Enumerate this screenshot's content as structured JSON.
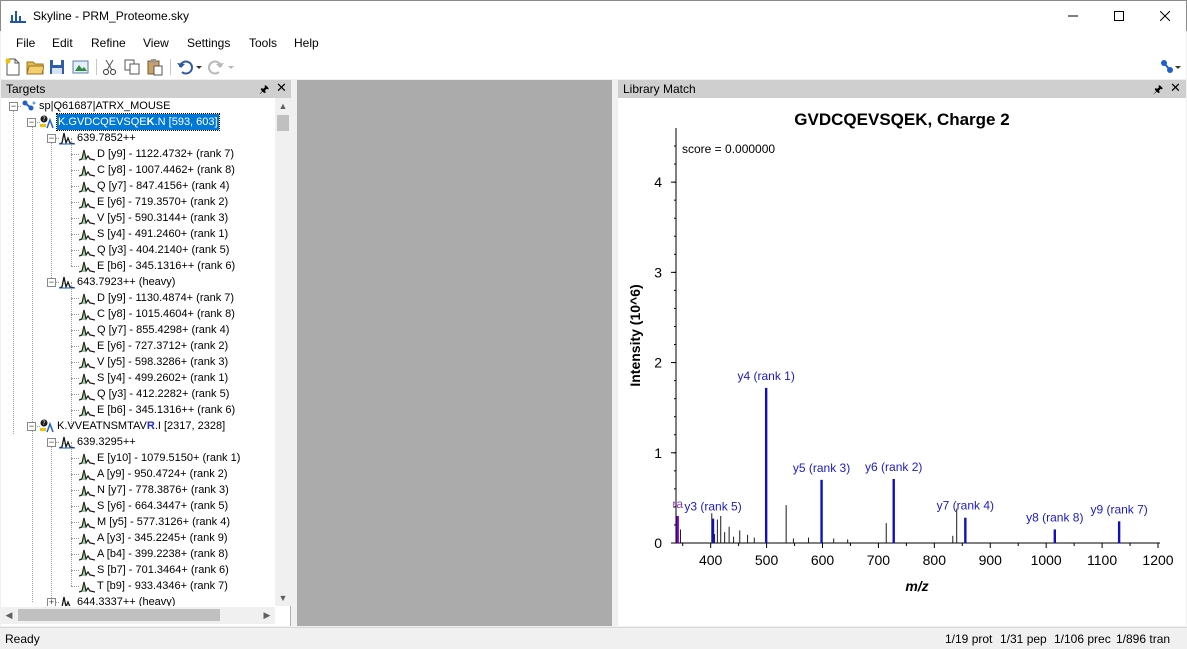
{
  "window": {
    "title": "Skyline - PRM_Proteome.sky"
  },
  "menu": [
    "File",
    "Edit",
    "Refine",
    "View",
    "Settings",
    "Tools",
    "Help"
  ],
  "targets_pane": {
    "title": "Targets"
  },
  "tree": [
    {
      "label": "sp|Q61687|ATRX_MOUSE"
    },
    {
      "label_pre": "K.GVDCQEVSQE",
      "label_bold": "K",
      "label_post": ".N [593, 603]"
    },
    {
      "label": "639.7852++"
    },
    {
      "label": "D [y9] - 1122.4732+ (rank 7)"
    },
    {
      "label": "C [y8] - 1007.4462+ (rank 8)"
    },
    {
      "label": "Q [y7] - 847.4156+ (rank 4)"
    },
    {
      "label": "E [y6] - 719.3570+ (rank 2)"
    },
    {
      "label": "V [y5] - 590.3144+ (rank 3)"
    },
    {
      "label": "S [y4] - 491.2460+ (rank 1)"
    },
    {
      "label": "Q [y3] - 404.2140+ (rank 5)"
    },
    {
      "label": "E [b6] - 345.1316++ (rank 6)"
    },
    {
      "label": "643.7923++ (heavy)"
    },
    {
      "label": "D [y9] - 1130.4874+ (rank 7)"
    },
    {
      "label": "C [y8] - 1015.4604+ (rank 8)"
    },
    {
      "label": "Q [y7] - 855.4298+ (rank 4)"
    },
    {
      "label": "E [y6] - 727.3712+ (rank 2)"
    },
    {
      "label": "V [y5] - 598.3286+ (rank 3)"
    },
    {
      "label": "S [y4] - 499.2602+ (rank 1)"
    },
    {
      "label": "Q [y3] - 412.2282+ (rank 5)"
    },
    {
      "label": "E [b6] - 345.1316++ (rank 6)"
    },
    {
      "label_pre": "K.VVEATNSMTAV",
      "label_bold": "R",
      "label_post": ".I [2317, 2328]"
    },
    {
      "label": "639.3295++"
    },
    {
      "label": "E [y10] - 1079.5150+ (rank 1)"
    },
    {
      "label": "A [y9] - 950.4724+ (rank 2)"
    },
    {
      "label": "N [y7] - 778.3876+ (rank 3)"
    },
    {
      "label": "S [y6] - 664.3447+ (rank 5)"
    },
    {
      "label": "M [y5] - 577.3126+ (rank 4)"
    },
    {
      "label": "A [y3] - 345.2245+ (rank 9)"
    },
    {
      "label": "A [b4] - 399.2238+ (rank 8)"
    },
    {
      "label": "S [b7] - 701.3464+ (rank 6)"
    },
    {
      "label": "T [b9] - 933.4346+ (rank 7)"
    },
    {
      "label": "644.3337++ (heavy)"
    }
  ],
  "library_pane": {
    "title": "Library Match"
  },
  "chart_data": {
    "type": "bar",
    "title": "GVDCQEVSQEK, Charge 2",
    "annotation": "score = 0.000000",
    "xlabel": "m/z",
    "ylabel": "Intensity (10^6)",
    "xlim": [
      338,
      1200
    ],
    "ylim": [
      0,
      4.6
    ],
    "xticks": [
      "400",
      "500",
      "600",
      "700",
      "800",
      "900",
      "1000",
      "1100",
      "1200"
    ],
    "yticks": [
      "0",
      "1",
      "2",
      "3",
      "4"
    ],
    "peaks": [
      {
        "mz": 341,
        "intensity": 0.3,
        "color": "#7a00cc"
      },
      {
        "mz": 346,
        "intensity": 0.15,
        "color": "#1a1a1a"
      },
      {
        "mz": 402,
        "intensity": 0.33,
        "color": "#1a1a1a"
      },
      {
        "mz": 407,
        "intensity": 0.1,
        "color": "#1a1a1a"
      },
      {
        "mz": 412,
        "intensity": 0.26,
        "color": "#1a1a1a"
      },
      {
        "mz": 418,
        "intensity": 0.3,
        "color": "#1a1a1a"
      },
      {
        "mz": 425,
        "intensity": 0.12,
        "color": "#1a1a1a"
      },
      {
        "mz": 433,
        "intensity": 0.18,
        "color": "#1a1a1a"
      },
      {
        "mz": 441,
        "intensity": 0.07,
        "color": "#1a1a1a"
      },
      {
        "mz": 452,
        "intensity": 0.14,
        "color": "#1a1a1a"
      },
      {
        "mz": 466,
        "intensity": 0.09,
        "color": "#1a1a1a"
      },
      {
        "mz": 478,
        "intensity": 0.06,
        "color": "#1a1a1a"
      },
      {
        "mz": 535,
        "intensity": 0.42,
        "color": "#1a1a1a"
      },
      {
        "mz": 548,
        "intensity": 0.05,
        "color": "#1a1a1a"
      },
      {
        "mz": 575,
        "intensity": 0.06,
        "color": "#1a1a1a"
      },
      {
        "mz": 620,
        "intensity": 0.05,
        "color": "#1a1a1a"
      },
      {
        "mz": 645,
        "intensity": 0.04,
        "color": "#1a1a1a"
      },
      {
        "mz": 714,
        "intensity": 0.22,
        "color": "#1a1a1a"
      },
      {
        "mz": 833,
        "intensity": 0.08,
        "color": "#1a1a1a"
      },
      {
        "mz": 840,
        "intensity": 0.38,
        "color": "#1a1a1a"
      },
      {
        "mz": 404.214,
        "intensity": 0.27,
        "color": "#1010c0"
      },
      {
        "mz": 499.26,
        "intensity": 1.72,
        "color": "#1010c0"
      },
      {
        "mz": 598.33,
        "intensity": 0.7,
        "color": "#1010c0"
      },
      {
        "mz": 727.37,
        "intensity": 0.71,
        "color": "#1010c0"
      },
      {
        "mz": 855.43,
        "intensity": 0.28,
        "color": "#1010c0"
      },
      {
        "mz": 1015.46,
        "intensity": 0.15,
        "color": "#1010c0"
      },
      {
        "mz": 1130.49,
        "intensity": 0.24,
        "color": "#1010c0"
      }
    ],
    "peak_labels": [
      {
        "text": "y4 (rank 1)",
        "mz": 499.26,
        "intensity": 1.72
      },
      {
        "text": "y5 (rank 3)",
        "mz": 598.33,
        "intensity": 0.7
      },
      {
        "text": "y6 (rank 2)",
        "mz": 727.37,
        "intensity": 0.71
      },
      {
        "text": "y7 (rank 4)",
        "mz": 855.43,
        "intensity": 0.28
      },
      {
        "text": "y8 (rank 8)",
        "mz": 1015.46,
        "intensity": 0.15
      },
      {
        "text": "y9 (rank 7)",
        "mz": 1130.49,
        "intensity": 0.24
      },
      {
        "text": "y3 (rank 5)",
        "mz": 404.214,
        "intensity": 0.27
      },
      {
        "text": "ra",
        "mz": 341,
        "intensity": 0.3
      }
    ]
  },
  "status": {
    "left": "Ready",
    "prot": "1/19 prot",
    "pep": "1/31 pep",
    "prec": "1/106 prec",
    "tran": "1/896 tran"
  }
}
